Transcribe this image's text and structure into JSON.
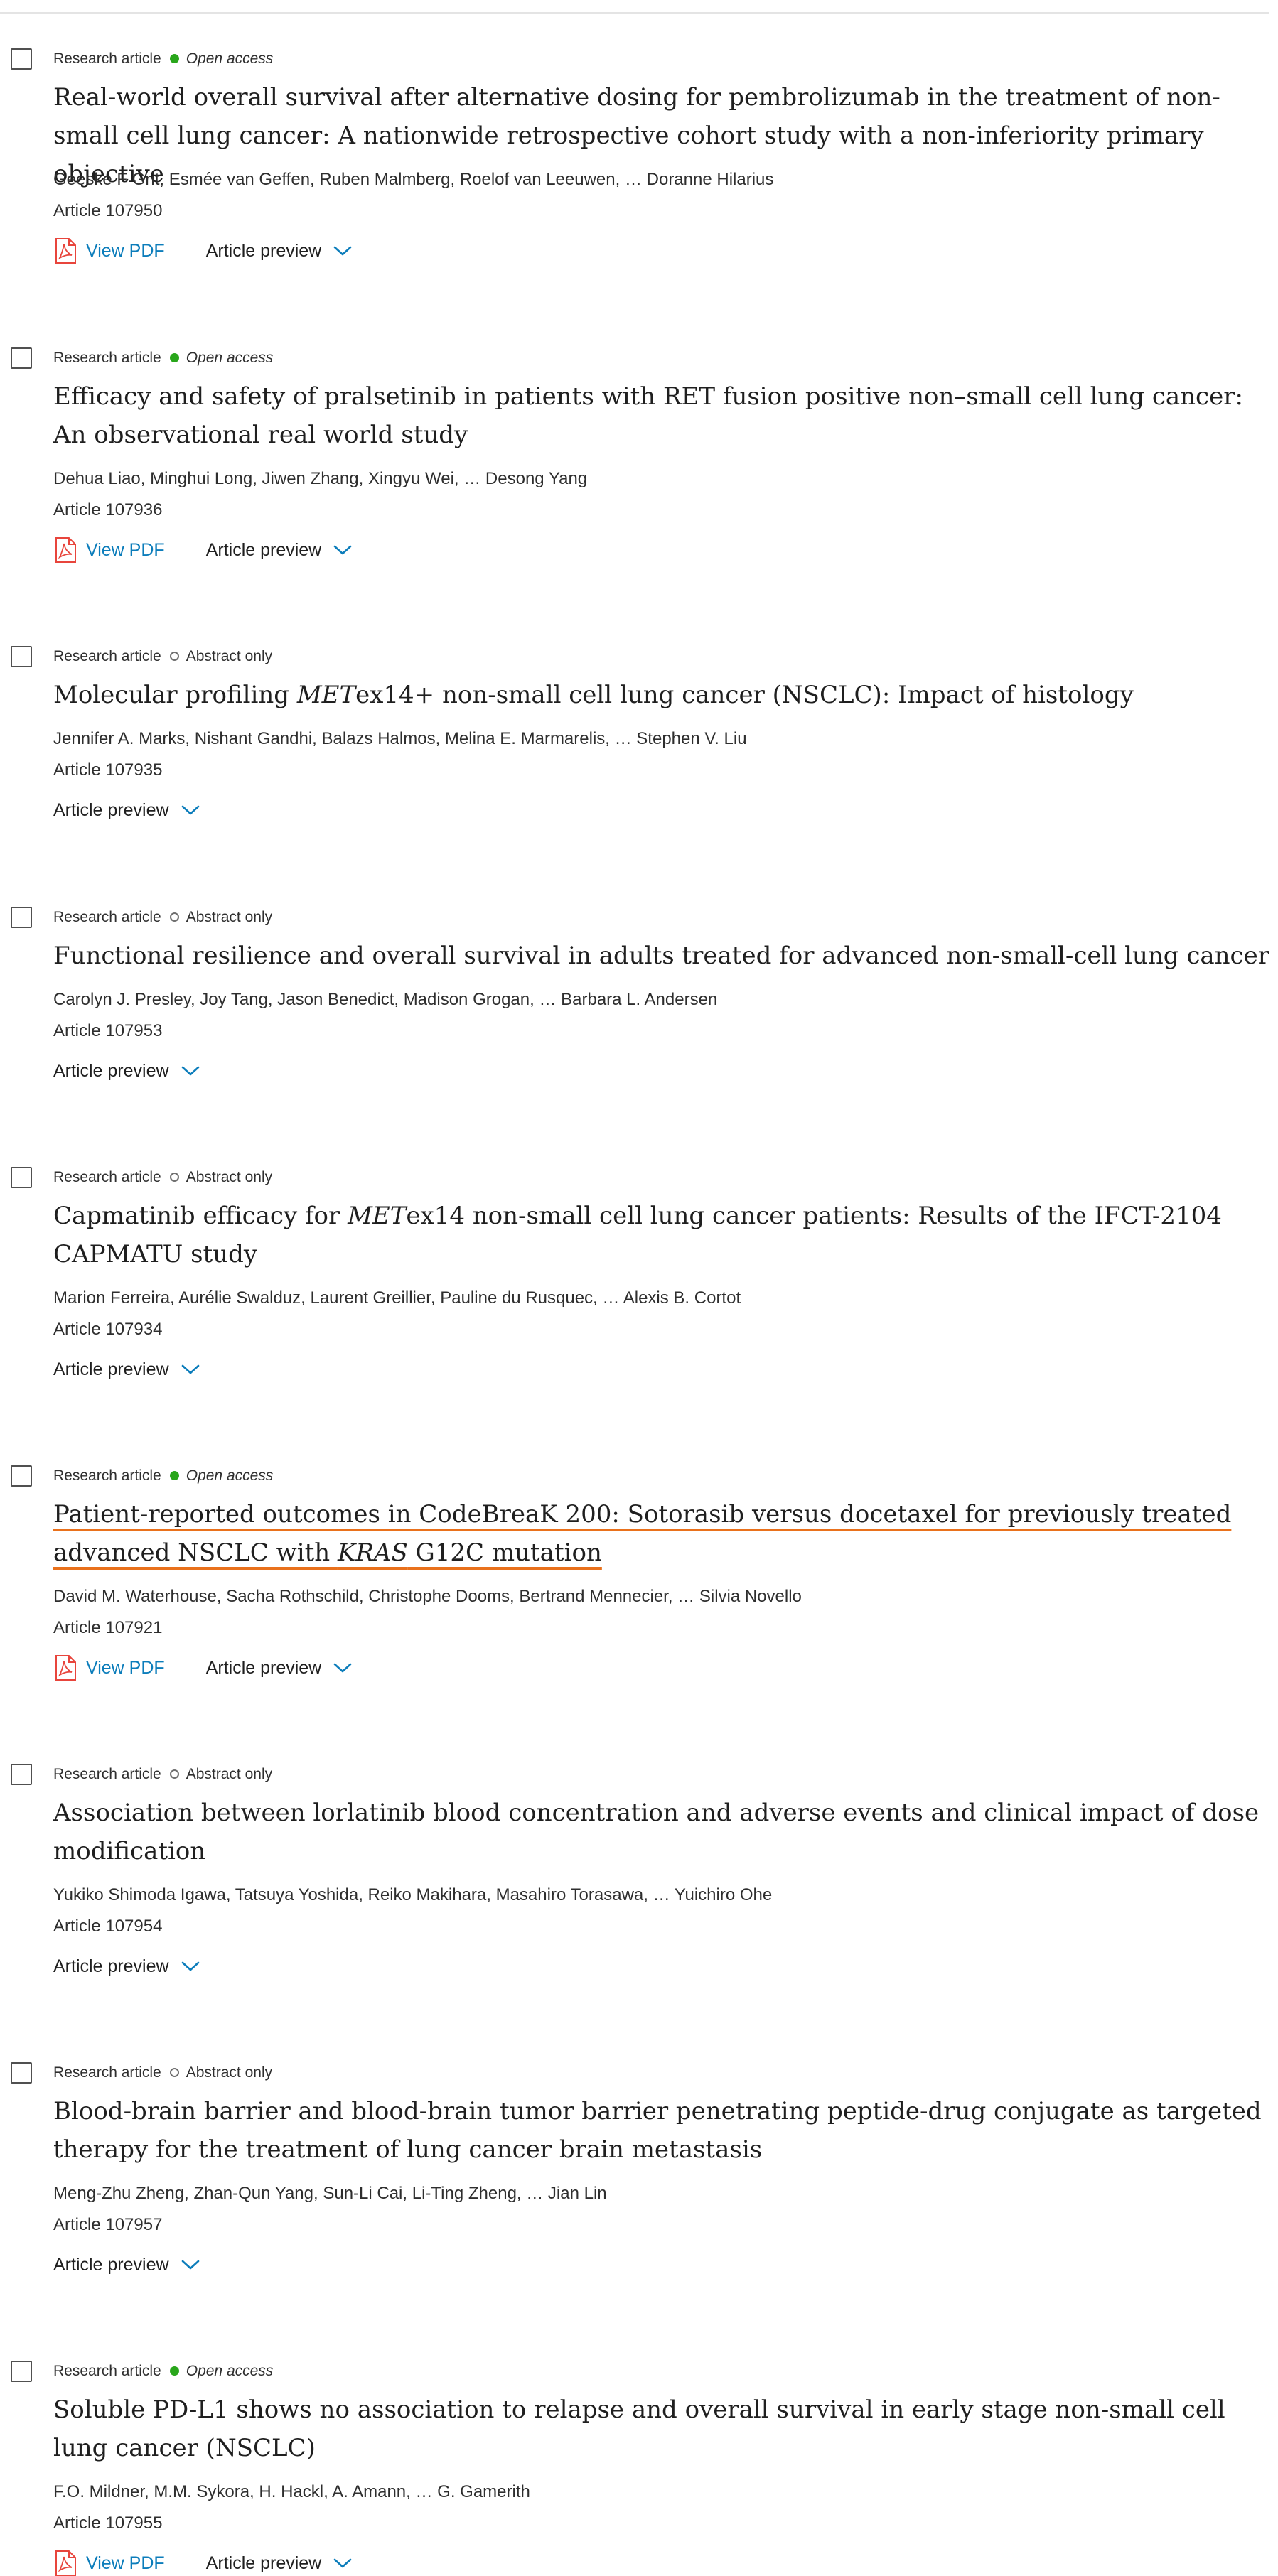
{
  "articles": [
    {
      "type_label": "Research article",
      "access": "open",
      "access_label": "Open access",
      "title_html": "Real-world overall survival after alternative dosing for pembrolizumab in the treatment of non-small cell lung cancer: A nationwide retrospective cohort study with a non-inferiority primary objective",
      "authors": "Geeske F Grit, Esmée van Geffen, Ruben Malmberg, Roelof van Leeuwen, … Doranne Hilarius",
      "article_number": "Article 107950",
      "has_pdf": true,
      "pdf_label": "View PDF",
      "preview_label": "Article preview",
      "focused": false
    },
    {
      "type_label": "Research article",
      "access": "open",
      "access_label": "Open access",
      "title_html": "Efficacy and safety of pralsetinib in patients with RET fusion positive non–small cell lung cancer: An observational real world study",
      "authors": "Dehua Liao, Minghui Long, Jiwen Zhang, Xingyu Wei, … Desong Yang",
      "article_number": "Article 107936",
      "has_pdf": true,
      "pdf_label": "View PDF",
      "preview_label": "Article preview",
      "focused": false
    },
    {
      "type_label": "Research article",
      "access": "abstract",
      "access_label": "Abstract only",
      "title_html": "Molecular profiling <i>MET</i>ex14+ non-small cell lung cancer (NSCLC): Impact of histology",
      "authors": "Jennifer A. Marks, Nishant Gandhi, Balazs Halmos, Melina E. Marmarelis, … Stephen V. Liu",
      "article_number": "Article 107935",
      "has_pdf": false,
      "preview_label": "Article preview",
      "focused": false
    },
    {
      "type_label": "Research article",
      "access": "abstract",
      "access_label": "Abstract only",
      "title_html": "Functional resilience and overall survival in adults treated for advanced non-small-cell lung cancer",
      "authors": "Carolyn J. Presley, Joy Tang, Jason Benedict, Madison Grogan, … Barbara L. Andersen",
      "article_number": "Article 107953",
      "has_pdf": false,
      "preview_label": "Article preview",
      "focused": false
    },
    {
      "type_label": "Research article",
      "access": "abstract",
      "access_label": "Abstract only",
      "title_html": "Capmatinib efficacy for <i>MET</i>ex14 non-small cell lung cancer patients: Results of the IFCT-2104 CAPMATU study",
      "authors": "Marion Ferreira, Aurélie Swalduz, Laurent Greillier, Pauline du Rusquec, … Alexis B. Cortot",
      "article_number": "Article 107934",
      "has_pdf": false,
      "preview_label": "Article preview",
      "focused": false
    },
    {
      "type_label": "Research article",
      "access": "open",
      "access_label": "Open access",
      "title_html": "Patient-reported outcomes in CodeBreaK 200: Sotorasib versus docetaxel for previously treated advanced NSCLC with <i>KRAS</i> G12C mutation",
      "authors": "David M. Waterhouse, Sacha Rothschild, Christophe Dooms, Bertrand Mennecier, … Silvia Novello",
      "article_number": "Article 107921",
      "has_pdf": true,
      "pdf_label": "View PDF",
      "preview_label": "Article preview",
      "focused": true
    },
    {
      "type_label": "Research article",
      "access": "abstract",
      "access_label": "Abstract only",
      "title_html": "Association between lorlatinib blood concentration and adverse events and clinical impact of dose modification",
      "authors": "Yukiko Shimoda Igawa, Tatsuya Yoshida, Reiko Makihara, Masahiro Torasawa, … Yuichiro Ohe",
      "article_number": "Article 107954",
      "has_pdf": false,
      "preview_label": "Article preview",
      "focused": false
    },
    {
      "type_label": "Research article",
      "access": "abstract",
      "access_label": "Abstract only",
      "title_html": "Blood-brain barrier and blood-brain tumor barrier penetrating peptide-drug conjugate as targeted therapy for the treatment of lung cancer brain metastasis",
      "authors": "Meng-Zhu Zheng, Zhan-Qun Yang, Sun-Li Cai, Li-Ting Zheng, … Jian Lin",
      "article_number": "Article 107957",
      "has_pdf": false,
      "preview_label": "Article preview",
      "focused": false
    },
    {
      "type_label": "Research article",
      "access": "open",
      "access_label": "Open access",
      "title_html": "Soluble PD-L1 shows no association to relapse and overall survival in early stage non-small cell lung cancer (NSCLC)",
      "authors": "F.O. Mildner, M.M. Sykora, H. Hackl, A. Amann, … G. Gamerith",
      "article_number": "Article 107955",
      "has_pdf": true,
      "pdf_label": "View PDF",
      "preview_label": "Article preview",
      "focused": false
    }
  ],
  "colors": {
    "link_blue": "#0c7dbb",
    "open_access_dot": "#29a61b",
    "focus_underline": "#e9711c",
    "pdf_icon_red": "#e8453c"
  },
  "icons": {
    "pdf": "pdf-file-icon",
    "preview_toggle": "chevron-down-icon",
    "open_access": "green-dot-icon",
    "abstract_only": "hollow-circle-icon"
  }
}
